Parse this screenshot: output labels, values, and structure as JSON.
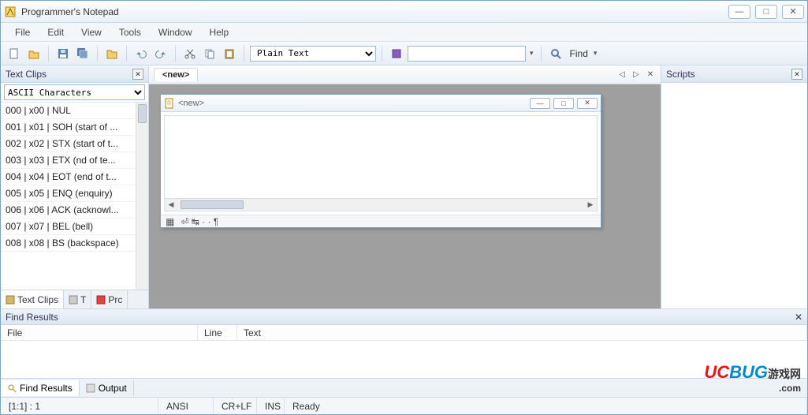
{
  "title": "Programmer's Notepad",
  "menu": [
    "File",
    "Edit",
    "View",
    "Tools",
    "Window",
    "Help"
  ],
  "toolbar": {
    "lang_selected": "Plain Text",
    "search_value": "",
    "find_label": "Find"
  },
  "left": {
    "title": "Text Clips",
    "category": "ASCII Characters",
    "items": [
      "000 | x00 | NUL",
      "001 | x01 | SOH (start of ...",
      "002 | x02 | STX (start of t...",
      "003 | x03 | ETX (nd of te...",
      "004 | x04 | EOT (end of t...",
      "005 | x05 | ENQ (enquiry)",
      "006 | x06 | ACK (acknowl...",
      "007 | x07 | BEL (bell)",
      "008 | x08 | BS (backspace)"
    ],
    "tabs": [
      "Text Clips",
      "T",
      "Prc"
    ]
  },
  "doc": {
    "tab": "<new>",
    "child_title": "<new>",
    "footer_symbols": "⏎ ↹ · · ¶"
  },
  "right": {
    "title": "Scripts"
  },
  "find": {
    "title": "Find Results",
    "cols": [
      "File",
      "Line",
      "Text"
    ],
    "tabs": [
      "Find Results",
      "Output"
    ]
  },
  "status": {
    "pos": "[1:1] : 1",
    "encoding": "ANSI",
    "eol": "CR+LF",
    "insert": "INS",
    "msg": "Ready"
  },
  "watermark": {
    "a": "UC",
    "b": "BUG",
    "c": "游戏网",
    "d": ".com"
  }
}
